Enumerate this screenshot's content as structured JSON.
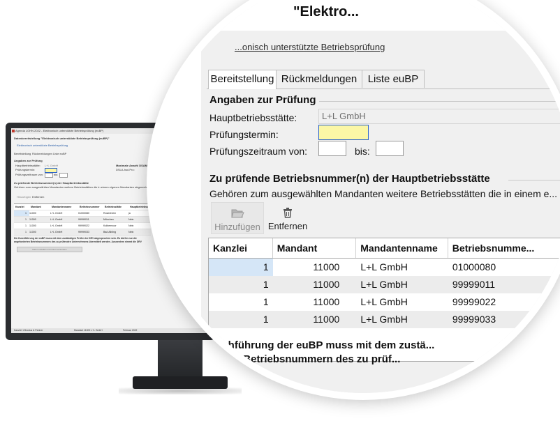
{
  "mini": {
    "window_title": "Agenda LOHN 2022 - Elektronisch unterstützte Betriebsprüfung (euBP)",
    "heading": "Datenbereitstellung \"Elektronisch unterstützte Betriebsprüfung (euBP)\"",
    "link": "Elektronisch unterstützte Betriebsprüfung",
    "tabs": [
      "Bereitstellung",
      "Rückmeldungen",
      "Liste euBP"
    ],
    "section_pruefung": "Angaben zur Prüfung",
    "labels": [
      "Hauptbetriebsstätte:",
      "Prüfungstermin:",
      "Prüfungszeitraum von:"
    ],
    "field_hbs": "L+L GmbH",
    "bis": "bis:",
    "right_label": "Maximale Anzahl DSAM je Paket: 1",
    "right_label2": "DSLA-hsd.Pro:",
    "section_betriebe": "Zu prüfende Betriebsnummer(n) der Hauptbetriebsstätte",
    "info": "Gehören zum ausgewählten Mandanten weitere Betriebsstätten die in einem eigenen Mandanten abgerechnet werden?",
    "tool_add": "Hinzufügen",
    "tool_remove": "Entfernen",
    "headers": [
      "Kanzlei",
      "Mandant",
      "Mandantenname",
      "Betriebsnummer",
      "Betriebsstätte",
      "Hauptbetriebsstä"
    ],
    "rows": [
      [
        "1",
        "11000",
        "L+L GmbH",
        "01000080",
        "Rosenheim",
        "ja"
      ],
      [
        "1",
        "11000",
        "L+L GmbH",
        "99999011",
        "München",
        "Nein"
      ],
      [
        "1",
        "11000",
        "L+L GmbH",
        "99999022",
        "Kolbermoor",
        "Nein"
      ],
      [
        "1",
        "11000",
        "L+L GmbH",
        "99999033",
        "Bad Aibling",
        "Nein"
      ]
    ],
    "bottom_note_1": "Die Durchführung der euBP muss mit dem zuständigen Prüfer der DRV abgesprochen sein. Es dürfen nur die",
    "bottom_note_2": "angeforderten Betriebsnummern des zu prüfenden Unternehmens übermittelt werden. Ausserdem nimmt die DRV",
    "action_button": "Daten erstellen und sofort versenden",
    "status_left": "Kanzlei 1 Brosius & Partner",
    "status_mid": "Mandant 11000 L+L GmbH",
    "status_right": "Februar 2022"
  },
  "zoom": {
    "app_title": "\"Elektro...",
    "link_text": "...onisch unterstützte Betriebsprüfung",
    "tabs": [
      "Bereitstellung",
      "Rückmeldungen",
      "Liste euBP"
    ],
    "section_pruefung": "Angaben zur Prüfung",
    "label_hbs": "Hauptbetriebsstätte:",
    "value_hbs": "L+L GmbH",
    "label_termin": "Prüfungstermin:",
    "value_termin": "",
    "label_zeitraum": "Prüfungszeitraum von:",
    "label_bis": "bis:",
    "section_betriebe": "Zu prüfende Betriebsnummer(n) der Hauptbetriebsstätte",
    "info": "Gehören zum ausgewählten Mandanten weitere Betriebsstätten die in einem e...",
    "tool_add": "Hinzufügen",
    "tool_remove": "Entfernen",
    "headers": [
      "Kanzlei",
      "Mandant",
      "Mandantenname",
      "Betriebsnumme..."
    ],
    "rows": [
      {
        "kanzlei": "1",
        "mandant": "11000",
        "name": "L+L GmbH",
        "betriebsnummer": "01000080"
      },
      {
        "kanzlei": "1",
        "mandant": "11000",
        "name": "L+L GmbH",
        "betriebsnummer": "99999011"
      },
      {
        "kanzlei": "1",
        "mandant": "11000",
        "name": "L+L GmbH",
        "betriebsnummer": "99999022"
      },
      {
        "kanzlei": "1",
        "mandant": "11000",
        "name": "L+L GmbH",
        "betriebsnummer": "99999033"
      }
    ],
    "bottom_line_1": "...rchführung der euBP muss mit dem zustä...",
    "bottom_line_2": "...nten Betriebsnummern des zu prüf..."
  },
  "icons": {
    "add": "folder-open-icon",
    "remove": "trash-icon"
  },
  "colors": {
    "focused_field": "#fbf7a6",
    "selected_cell": "#d5e6f7",
    "alt_row": "#ececec",
    "window_bg": "#f0f0f0"
  }
}
